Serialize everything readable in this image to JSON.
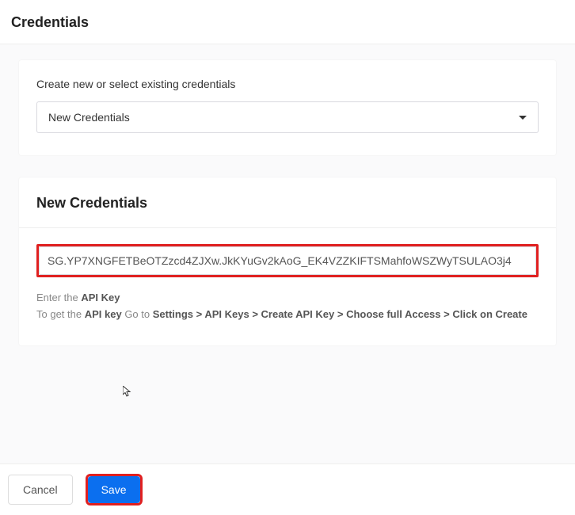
{
  "header": {
    "title": "Credentials"
  },
  "selector": {
    "label": "Create new or select existing credentials",
    "selected": "New Credentials"
  },
  "form": {
    "title": "New Credentials",
    "api_key_value": "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",
    "help1_prefix": "Enter the ",
    "help1_strong": "API Key",
    "help2_prefix": "To get the ",
    "help2_strong1": "API key",
    "help2_mid": " Go to ",
    "help2_strong2": "Settings > API Keys > Create API Key > Choose full Access > Click on Create"
  },
  "footer": {
    "cancel": "Cancel",
    "save": "Save"
  }
}
